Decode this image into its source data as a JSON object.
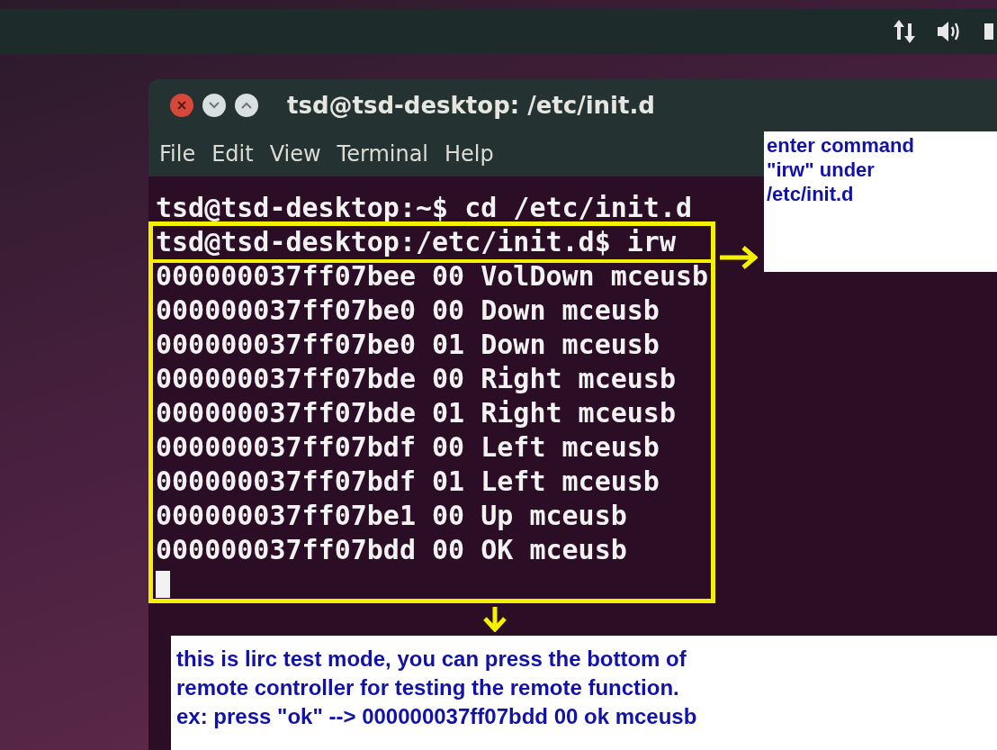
{
  "window": {
    "title": "tsd@tsd-desktop: /etc/init.d"
  },
  "menu": [
    "File",
    "Edit",
    "View",
    "Terminal",
    "Help"
  ],
  "terminal": {
    "lines": [
      "tsd@tsd-desktop:~$ cd /etc/init.d",
      "tsd@tsd-desktop:/etc/init.d$ irw",
      "000000037ff07bee 00 VolDown mceusb",
      "000000037ff07be0 00 Down mceusb",
      "000000037ff07be0 01 Down mceusb",
      "000000037ff07bde 00 Right mceusb",
      "000000037ff07bde 01 Right mceusb",
      "000000037ff07bdf 00 Left mceusb",
      "000000037ff07bdf 01 Left mceusb",
      "000000037ff07be1 00 Up mceusb",
      "000000037ff07bdd 00 OK mceusb"
    ]
  },
  "annotations": {
    "side_note": "enter command\n\"irw\" under\n/etc/init.d",
    "bottom_note": "this is lirc test mode, you can press the bottom of\nremote controller for testing the remote function.\nex: press \"ok\" --> 000000037ff07bdd 00 ok mceusb"
  }
}
